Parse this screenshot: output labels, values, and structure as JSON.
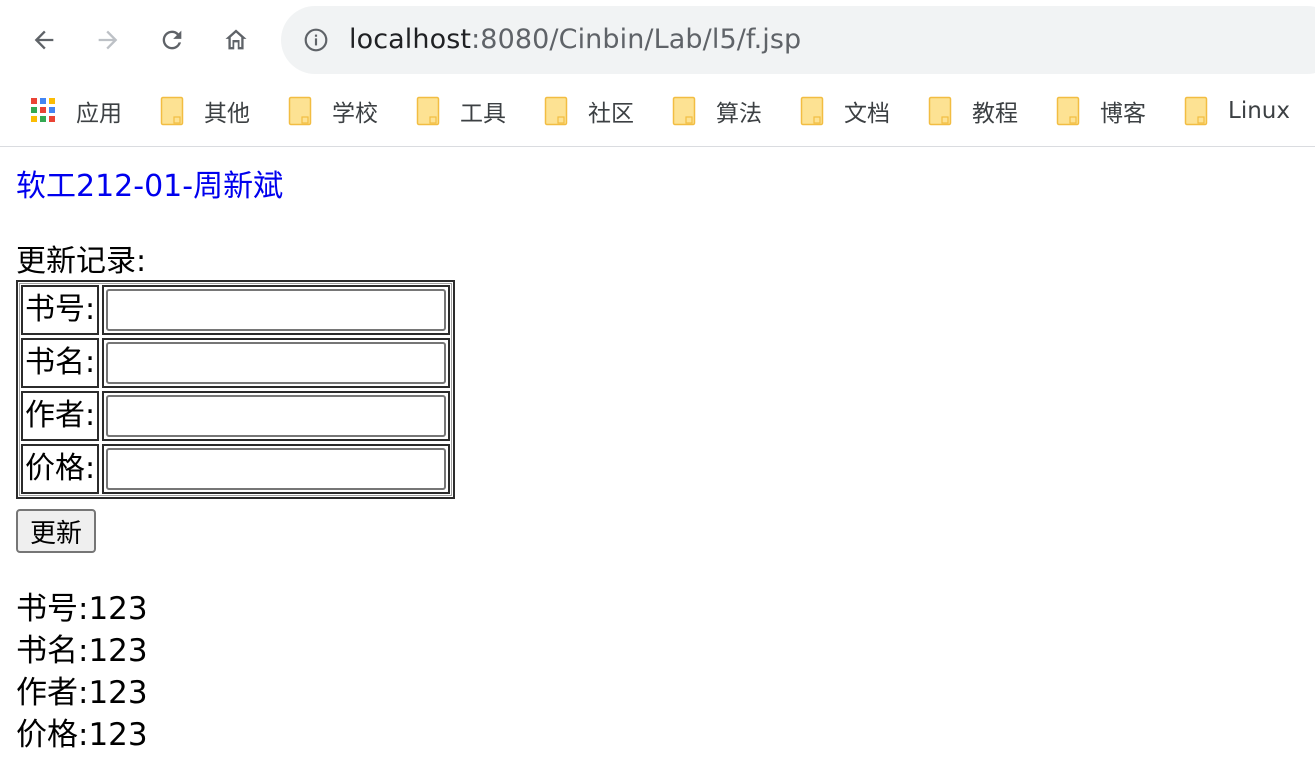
{
  "browser": {
    "url_host": "localhost",
    "url_rest": ":8080/Cinbin/Lab/l5/f.jsp",
    "icons": {
      "back": "back-arrow-icon",
      "forward": "forward-arrow-icon",
      "reload": "reload-icon",
      "home": "home-icon",
      "site_info": "info-icon"
    },
    "bookmarks": [
      {
        "label": "应用",
        "icon": "apps-grid-icon"
      },
      {
        "label": "其他",
        "icon": "folder-icon"
      },
      {
        "label": "学校",
        "icon": "folder-icon"
      },
      {
        "label": "工具",
        "icon": "folder-icon"
      },
      {
        "label": "社区",
        "icon": "folder-icon"
      },
      {
        "label": "算法",
        "icon": "folder-icon"
      },
      {
        "label": "文档",
        "icon": "folder-icon"
      },
      {
        "label": "教程",
        "icon": "folder-icon"
      },
      {
        "label": "博客",
        "icon": "folder-icon"
      },
      {
        "label": "Linux",
        "icon": "folder-icon"
      }
    ]
  },
  "page": {
    "author": "软工212-01-周新斌",
    "form_title": "更新记录:",
    "fields": [
      {
        "label": "书号:",
        "value": ""
      },
      {
        "label": "书名:",
        "value": ""
      },
      {
        "label": "作者:",
        "value": ""
      },
      {
        "label": "价格:",
        "value": ""
      }
    ],
    "submit_label": "更新",
    "results": [
      "书号:123",
      "书名:123",
      "作者:123",
      "价格:123"
    ]
  },
  "colors": {
    "link": "#0000ee",
    "omnibox_bg": "#f1f3f4",
    "folder_fill": "#fde293",
    "folder_stroke": "#f2bd42"
  }
}
